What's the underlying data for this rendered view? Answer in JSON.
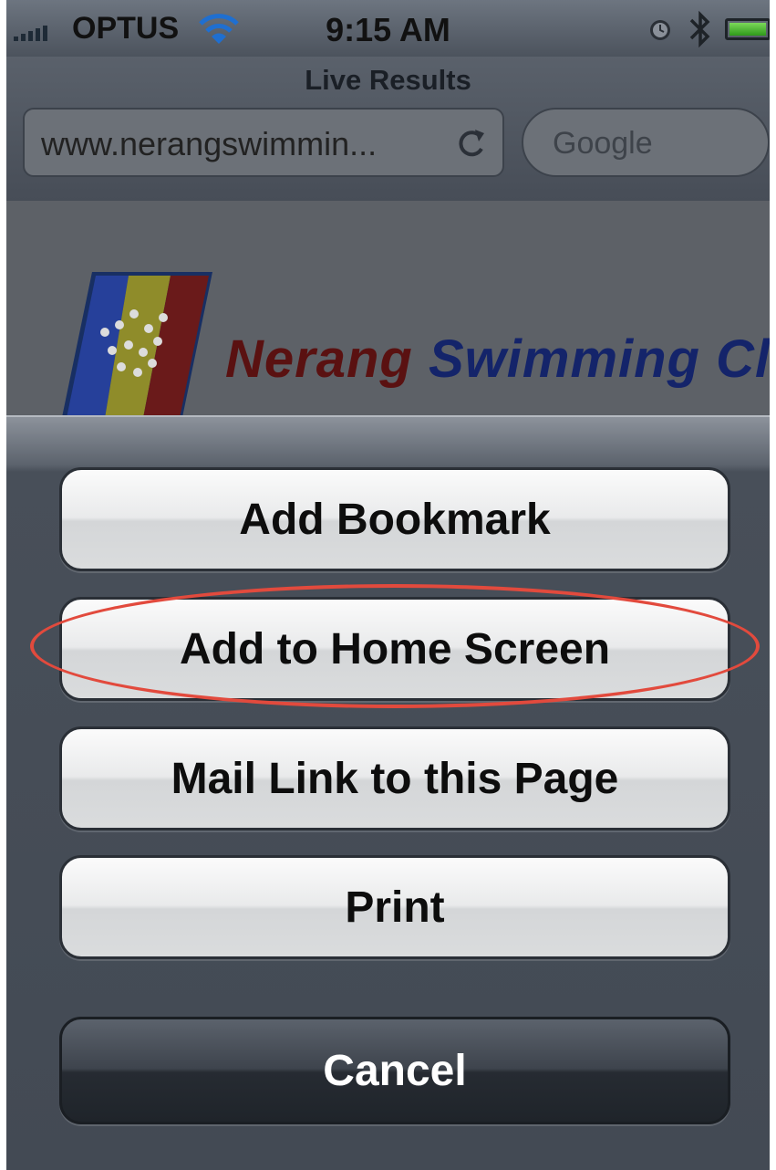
{
  "status_bar": {
    "carrier": "OPTUS",
    "time": "9:15 AM",
    "icons": [
      "signal-icon",
      "wifi-icon",
      "alarm-icon",
      "bluetooth-icon",
      "battery-icon"
    ]
  },
  "browser": {
    "page_title": "Live Results",
    "url": "www.nerangswimmin...",
    "search_placeholder": "Google"
  },
  "page": {
    "club_name_part1": "Nerang",
    "club_name_part2": "Swimming Club"
  },
  "action_sheet": {
    "add_bookmark": "Add Bookmark",
    "add_to_home_screen": "Add to Home Screen",
    "mail_link": "Mail Link to this Page",
    "print": "Print",
    "cancel": "Cancel"
  },
  "colors": {
    "highlight": "#e24a3d",
    "club_red": "#5a1111",
    "club_blue": "#14246a"
  }
}
